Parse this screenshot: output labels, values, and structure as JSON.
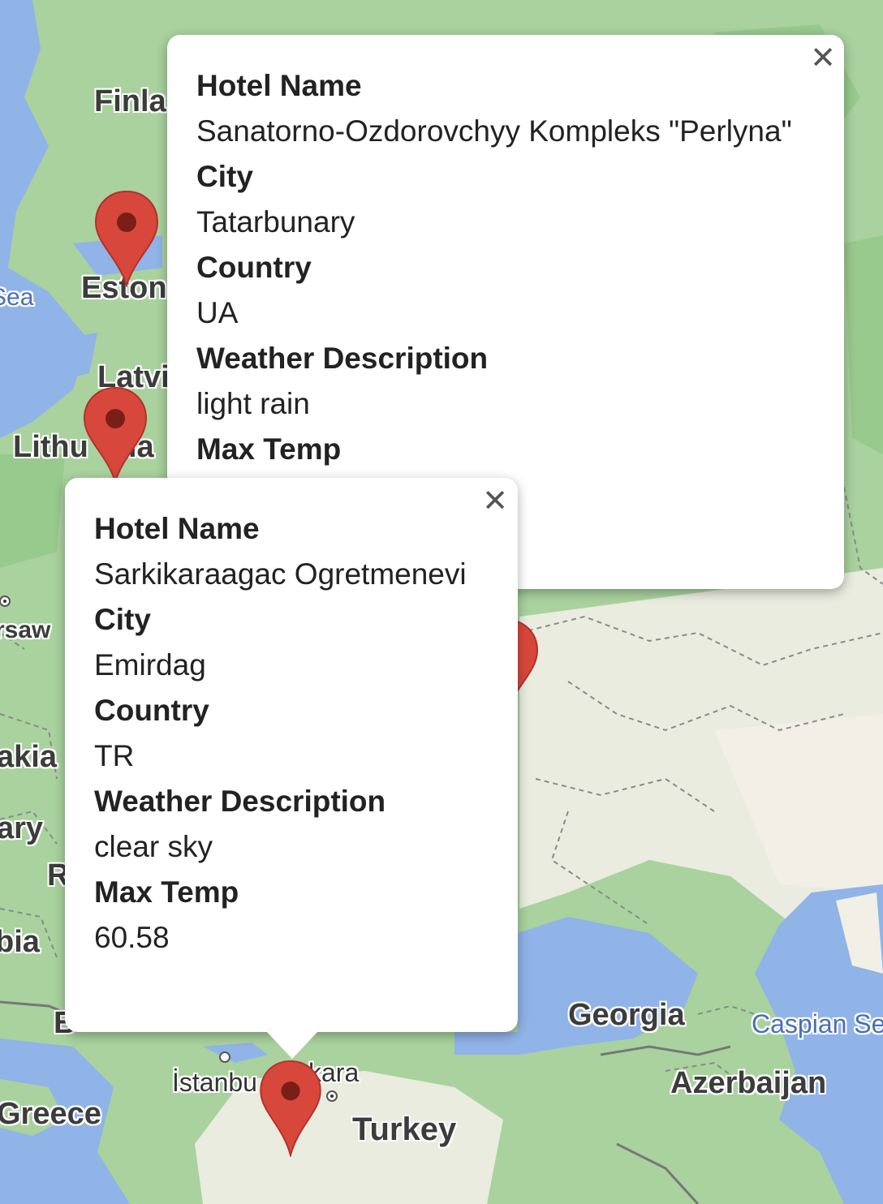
{
  "map": {
    "labels": {
      "finland": "Finla",
      "estonia": "Eston",
      "sea": "Sea",
      "latvia": "Latvi",
      "lithuania": "Lithu",
      "lithuania_end": "ia",
      "warsaw": "rsaw",
      "slovakia": "akia",
      "hungary": "ary",
      "romania": "R",
      "serbia": "bia",
      "bulgaria": "B",
      "georgia": "Georgia",
      "caspian": "Caspian Se",
      "istanbul": "İstanbu",
      "ankara": "kara",
      "azerbaijan": "Azerbaijan",
      "greece": "Greece",
      "turkey": "Turkey"
    },
    "marker_color": "#d8473b"
  },
  "info_windows": [
    {
      "fields": [
        {
          "label": "Hotel Name",
          "value": "Sanatorno-Ozdorovchyy Kompleks \"Perlyna\""
        },
        {
          "label": "City",
          "value": "Tatarbunary"
        },
        {
          "label": "Country",
          "value": "UA"
        },
        {
          "label": "Weather Description",
          "value": "light rain"
        },
        {
          "label": "Max Temp",
          "value": ""
        }
      ],
      "close_symbol": "✕"
    },
    {
      "fields": [
        {
          "label": "Hotel Name",
          "value": "Sarkikaraagac Ogretmenevi"
        },
        {
          "label": "City",
          "value": "Emirdag"
        },
        {
          "label": "Country",
          "value": "TR"
        },
        {
          "label": "Weather Description",
          "value": "clear sky"
        },
        {
          "label": "Max Temp",
          "value": "60.58"
        }
      ],
      "close_symbol": "✕"
    }
  ]
}
